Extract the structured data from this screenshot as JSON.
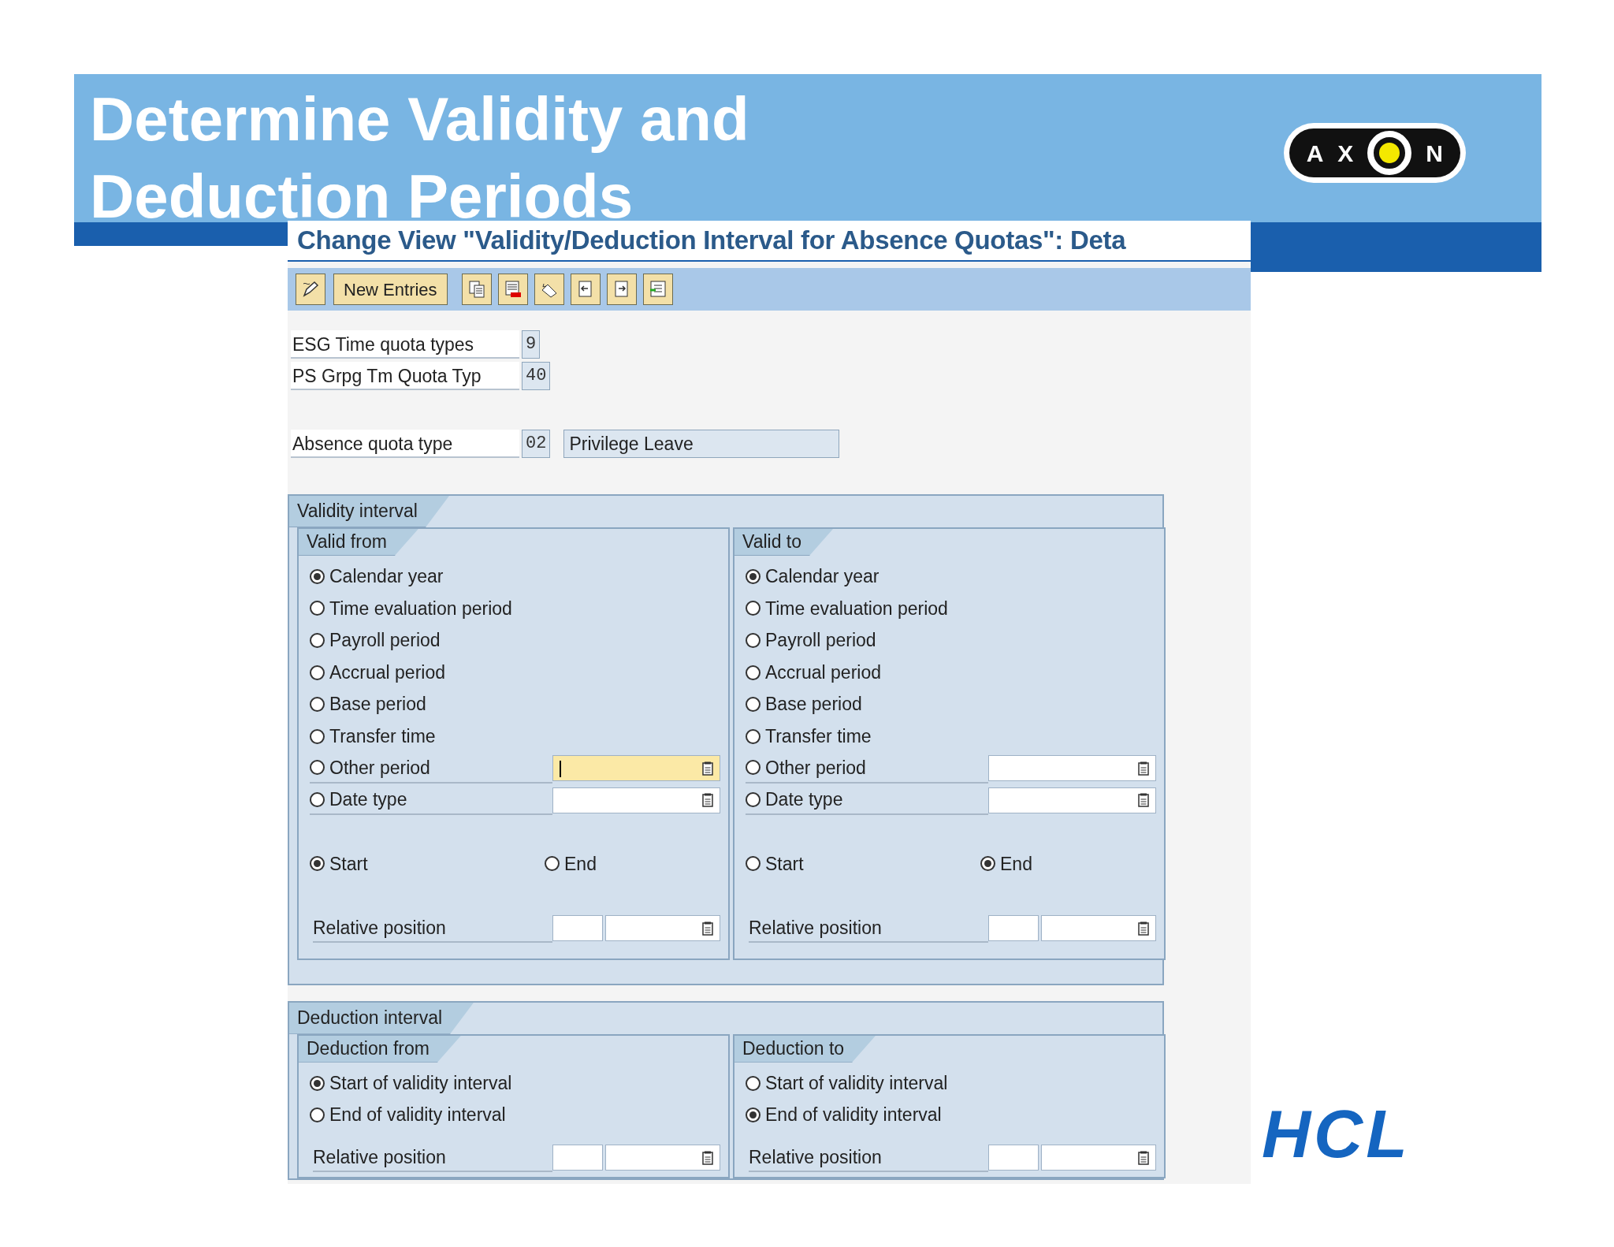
{
  "slide": {
    "title_lines": [
      "Determine Validity and",
      "Deduction Periods"
    ]
  },
  "axon_logo": {
    "letters_before": [
      "A",
      "X"
    ],
    "letters_after": [
      "N"
    ]
  },
  "hcl_logo": {
    "text": "HCL"
  },
  "sap": {
    "title": "Change View \"Validity/Deduction Interval for Absence Quotas\": Deta",
    "toolbar": {
      "new_entries": "New Entries"
    },
    "header_fields": [
      {
        "label": "ESG Time quota types",
        "value": "9"
      },
      {
        "label": "PS Grpg Tm Quota Typ",
        "value": "40"
      },
      {
        "label": "Absence quota type",
        "value": "02",
        "description": "Privilege Leave"
      }
    ],
    "validity_interval": {
      "title": "Validity interval",
      "columns": [
        {
          "title": "Valid from",
          "options": [
            {
              "kind": "radio",
              "label": "Calendar year",
              "selected": true
            },
            {
              "kind": "radio",
              "label": "Time evaluation period",
              "selected": false
            },
            {
              "kind": "radio",
              "label": "Payroll period",
              "selected": false
            },
            {
              "kind": "radio",
              "label": "Accrual period",
              "selected": false
            },
            {
              "kind": "radio",
              "label": "Base period",
              "selected": false
            },
            {
              "kind": "radio",
              "label": "Transfer time",
              "selected": false
            },
            {
              "kind": "radio_field",
              "label": "Other period",
              "selected": false,
              "focused": true
            },
            {
              "kind": "radio_field",
              "label": "Date type",
              "selected": false,
              "focused": false
            }
          ],
          "anchor": [
            {
              "label": "Start",
              "selected": true
            },
            {
              "label": "End",
              "selected": false
            }
          ],
          "relative_position_label": "Relative position"
        },
        {
          "title": "Valid to",
          "options": [
            {
              "kind": "radio",
              "label": "Calendar year",
              "selected": true
            },
            {
              "kind": "radio",
              "label": "Time evaluation period",
              "selected": false
            },
            {
              "kind": "radio",
              "label": "Payroll period",
              "selected": false
            },
            {
              "kind": "radio",
              "label": "Accrual period",
              "selected": false
            },
            {
              "kind": "radio",
              "label": "Base period",
              "selected": false
            },
            {
              "kind": "radio",
              "label": "Transfer time",
              "selected": false
            },
            {
              "kind": "radio_field",
              "label": "Other period",
              "selected": false,
              "focused": false
            },
            {
              "kind": "radio_field",
              "label": "Date type",
              "selected": false,
              "focused": false
            }
          ],
          "anchor": [
            {
              "label": "Start",
              "selected": false
            },
            {
              "label": "End",
              "selected": true
            }
          ],
          "relative_position_label": "Relative position"
        }
      ]
    },
    "deduction_interval": {
      "title": "Deduction interval",
      "columns": [
        {
          "title": "Deduction from",
          "options": [
            {
              "kind": "radio",
              "label": "Start of validity interval",
              "selected": true
            },
            {
              "kind": "radio",
              "label": "End of validity interval",
              "selected": false
            }
          ],
          "relative_position_label": "Relative position"
        },
        {
          "title": "Deduction to",
          "options": [
            {
              "kind": "radio",
              "label": "Start of validity interval",
              "selected": false
            },
            {
              "kind": "radio",
              "label": "End of validity interval",
              "selected": true
            }
          ],
          "relative_position_label": "Relative position"
        }
      ]
    }
  }
}
